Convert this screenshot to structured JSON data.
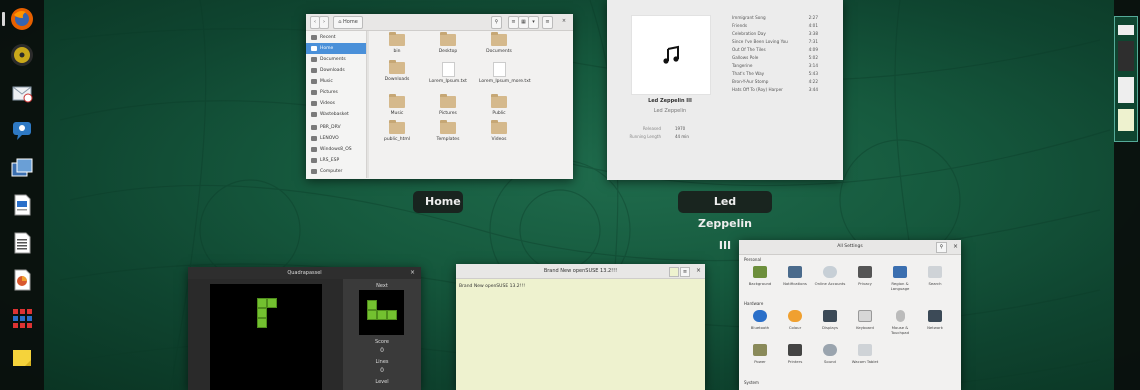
{
  "dash": {
    "apps": [
      {
        "name": "Firefox",
        "icon": "firefox-icon",
        "color": "#e66000"
      },
      {
        "name": "Rhythmbox",
        "icon": "rhythmbox-icon",
        "color": "#c9a81a"
      },
      {
        "name": "Evolution",
        "icon": "evolution-icon",
        "color": "#cfd8e2"
      },
      {
        "name": "Empathy",
        "icon": "empathy-icon",
        "color": "#2e79c4"
      },
      {
        "name": "Shotwell",
        "icon": "shotwell-icon",
        "color": "#3b6fb0"
      },
      {
        "name": "Writer",
        "icon": "writer-icon",
        "color": "#2a6fc9"
      },
      {
        "name": "Calc",
        "icon": "calc-icon",
        "color": "#dfe3e6"
      },
      {
        "name": "Impress",
        "icon": "impress-icon",
        "color": "#d0d0d0"
      },
      {
        "name": "Apps Grid",
        "icon": "apps-grid-icon",
        "color": "#d33"
      },
      {
        "name": "Notes",
        "icon": "notes-icon",
        "color": "#f5d33b"
      }
    ]
  },
  "windows": {
    "files": {
      "caption": "Home",
      "path_label": "Home",
      "sidebar": [
        "Recent",
        "Home",
        "Documents",
        "Downloads",
        "Music",
        "Pictures",
        "Videos",
        "Wastebasket",
        "PBR_DRV",
        "LENOVO",
        "Windows8_OS",
        "LRS_ESP",
        "Computer"
      ],
      "items": [
        "bin",
        "Desktop",
        "Documents",
        "Downloads",
        "Lorem_Ipsum.txt",
        "Lorem_Ipsum_more.txt",
        "Music",
        "Pictures",
        "Public",
        "public_html",
        "Templates",
        "Videos"
      ]
    },
    "music": {
      "caption": "Led Zeppelin III",
      "album": "Led Zeppelin III",
      "artist": "Led Zeppelin",
      "released_label": "Released",
      "released": "1970",
      "length_label": "Running Length",
      "length": "44 min",
      "tracks": [
        {
          "name": "Immigrant Song",
          "time": "2:27"
        },
        {
          "name": "Friends",
          "time": "4:01"
        },
        {
          "name": "Celebration Day",
          "time": "3:38"
        },
        {
          "name": "Since I've Been Loving You",
          "time": "7:31"
        },
        {
          "name": "Out Of The Tiles",
          "time": "4:09"
        },
        {
          "name": "Gallows Pole",
          "time": "5:02"
        },
        {
          "name": "Tangerine",
          "time": "3:14"
        },
        {
          "name": "That's The Way",
          "time": "5:43"
        },
        {
          "name": "Bron-Y-Aur Stomp",
          "time": "4:22"
        },
        {
          "name": "Hats Off To (Roy) Harper",
          "time": "3:44"
        }
      ]
    },
    "quadrapassel": {
      "title": "Quadrapassel",
      "next_label": "Next",
      "score_label": "Score",
      "score": "0",
      "lines_label": "Lines",
      "lines": "0",
      "level_label": "Level"
    },
    "gedit": {
      "title": "Brand New openSUSE 13.2!!!",
      "text": "Brand New openSUSE 13.2!!!"
    },
    "settings": {
      "title": "All Settings",
      "sections": [
        "Personal",
        "Hardware",
        "System"
      ],
      "personal": [
        "Background",
        "Notifications",
        "Online Accounts",
        "Privacy",
        "Region & Language",
        "Search"
      ],
      "hardware": [
        "Bluetooth",
        "Colour",
        "Displays",
        "Keyboard",
        "Mouse & Touchpad",
        "Network"
      ],
      "hardware2": [
        "Power",
        "Printers",
        "Sound",
        "Wacom Tablet"
      ]
    }
  }
}
